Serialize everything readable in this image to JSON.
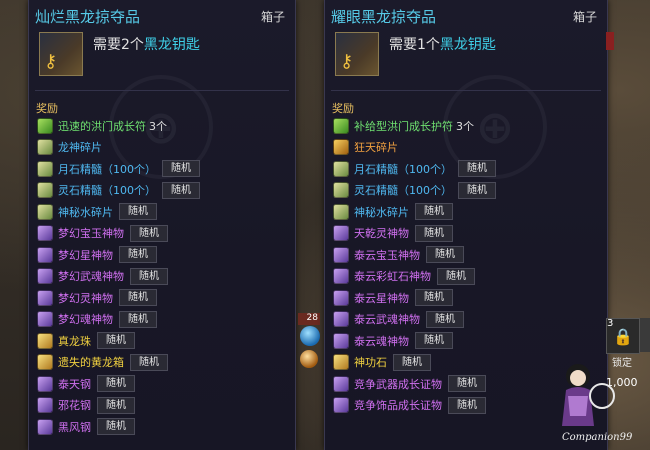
{
  "left_panel": {
    "title": "灿烂黑龙掠夺品",
    "chest_label": "箱子",
    "req_prefix": "需要2个",
    "req_item": "黑龙钥匙",
    "section": "奖励",
    "items": [
      {
        "name": "迅速的洪门成长符",
        "count": "3个",
        "color": "green",
        "icon": "talisman-icon"
      },
      {
        "name": "龙神碎片",
        "count": "",
        "color": "blue",
        "icon": "dragon-shard-icon"
      },
      {
        "name": "月石精髓（100个）",
        "tag": "随机",
        "color": "blue",
        "icon": "moonstone-icon"
      },
      {
        "name": "灵石精髓（100个）",
        "tag": "随机",
        "color": "blue",
        "icon": "spiritstone-icon"
      },
      {
        "name": "神秘水碎片",
        "tag": "随机",
        "color": "blue",
        "icon": "water-shard-icon"
      },
      {
        "name": "梦幻宝玉神物",
        "tag": "随机",
        "color": "purple",
        "icon": "gem-icon"
      },
      {
        "name": "梦幻星神物",
        "tag": "随机",
        "color": "purple",
        "icon": "star-gem-icon"
      },
      {
        "name": "梦幻武魂神物",
        "tag": "随机",
        "color": "purple",
        "icon": "soul-gem-icon"
      },
      {
        "name": "梦幻灵神物",
        "tag": "随机",
        "color": "purple",
        "icon": "spirit-gem-icon"
      },
      {
        "name": "梦幻魂神物",
        "tag": "随机",
        "color": "purple",
        "icon": "crystal-icon"
      },
      {
        "name": "真龙珠",
        "tag": "随机",
        "color": "yellow",
        "icon": "dragon-pearl-icon"
      },
      {
        "name": "遗失的黄龙箱",
        "tag": "随机",
        "color": "yellow",
        "icon": "chest-icon"
      },
      {
        "name": "泰天钢",
        "tag": "随机",
        "color": "purple",
        "icon": "steel-icon"
      },
      {
        "name": "邪花钢",
        "tag": "随机",
        "color": "purple",
        "icon": "flower-steel-icon"
      },
      {
        "name": "黑风钢",
        "tag": "随机",
        "color": "purple",
        "icon": "wind-steel-icon"
      }
    ]
  },
  "right_panel": {
    "title": "耀眼黑龙掠夺品",
    "chest_label": "箱子",
    "req_prefix": "需要1个",
    "req_item": "黑龙钥匙",
    "section": "奖励",
    "items": [
      {
        "name": "补给型洪门成长护符",
        "count": "3个",
        "color": "green",
        "icon": "amulet-icon"
      },
      {
        "name": "狂天碎片",
        "count": "",
        "color": "orange",
        "icon": "sky-shard-icon"
      },
      {
        "name": "月石精髓（100个）",
        "tag": "随机",
        "color": "blue",
        "icon": "moonstone-icon"
      },
      {
        "name": "灵石精髓（100个）",
        "tag": "随机",
        "color": "blue",
        "icon": "spiritstone-icon"
      },
      {
        "name": "神秘水碎片",
        "tag": "随机",
        "color": "blue",
        "icon": "water-shard-icon"
      },
      {
        "name": "天乾灵神物",
        "tag": "随机",
        "color": "purple",
        "icon": "heaven-gem-icon"
      },
      {
        "name": "泰云宝玉神物",
        "tag": "随机",
        "color": "purple",
        "icon": "cloud-gem-icon"
      },
      {
        "name": "泰云彩虹石神物",
        "tag": "随机",
        "color": "purple",
        "icon": "rainbow-gem-icon"
      },
      {
        "name": "泰云星神物",
        "tag": "随机",
        "color": "purple",
        "icon": "cloud-star-icon"
      },
      {
        "name": "泰云武魂神物",
        "tag": "随机",
        "color": "purple",
        "icon": "cloud-soul-icon"
      },
      {
        "name": "泰云魂神物",
        "tag": "随机",
        "color": "purple",
        "icon": "cloud-crystal-icon"
      },
      {
        "name": "神功石",
        "tag": "随机",
        "color": "yellow",
        "icon": "power-stone-icon"
      },
      {
        "name": "竞争武器成长证物",
        "tag": "随机",
        "color": "purple",
        "icon": "weapon-proof-icon"
      },
      {
        "name": "竞争饰品成长证物",
        "tag": "随机",
        "color": "purple",
        "icon": "accessory-proof-icon"
      }
    ]
  },
  "hud": {
    "badge": "28",
    "lock_count": "3",
    "lock_label": "锁定",
    "number": "1,000",
    "brand": "Companion99"
  },
  "colors": {
    "green": "#6fe070",
    "blue": "#4fb8f0",
    "purple": "#d070f0",
    "yellow": "#f0d040",
    "orange": "#f0a040"
  }
}
